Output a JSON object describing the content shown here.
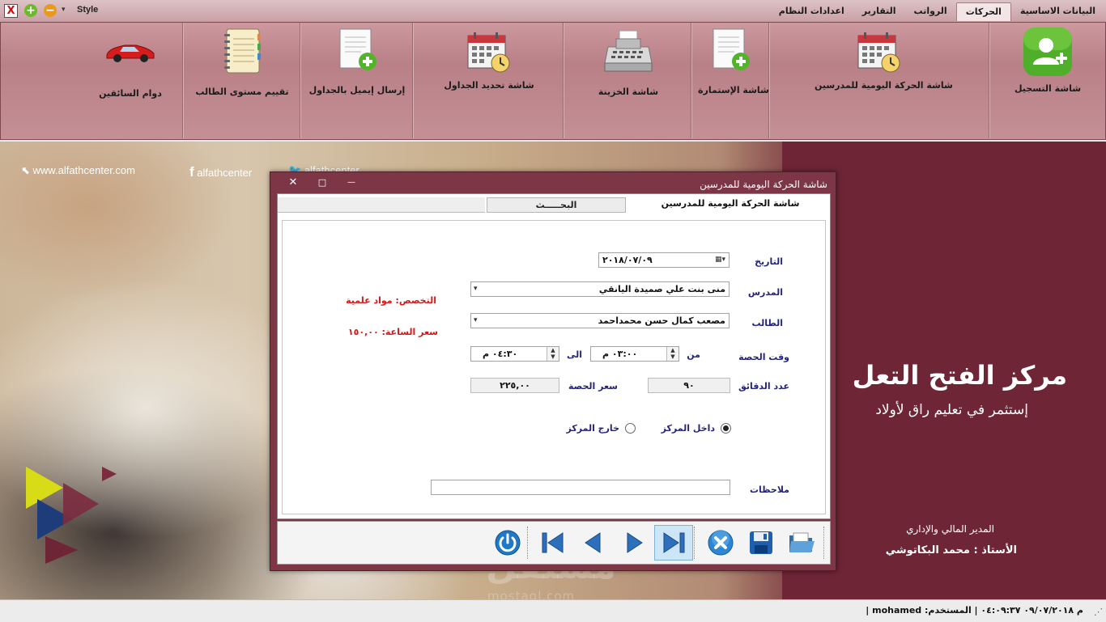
{
  "quick_access": {
    "close_glyph": "X",
    "add_glyph": "+",
    "remove_glyph": "−",
    "dropdown_glyph": "▾",
    "style_label": "Style"
  },
  "tabs": [
    "البيانات الاساسية",
    "الحركات",
    "الرواتب",
    "التقارير",
    "اعدادات النظام"
  ],
  "active_tab": "الحركات",
  "ribbon": {
    "buttons": [
      {
        "label": "شاشة التسجيل",
        "icon": "add-user-icon"
      },
      {
        "label": "شاشة الحركة اليومية للمدرسين",
        "icon": "calendar-clock-icon"
      },
      {
        "label": "شاشة الإستمارة",
        "icon": "form-add-icon"
      },
      {
        "label": "شاشة الخزينة",
        "icon": "cash-register-icon"
      },
      {
        "label": "شاشة تحديد الجداول",
        "icon": "calendar-clock-icon"
      },
      {
        "label": "إرسال إيميل بالجداول",
        "icon": "form-add-icon"
      },
      {
        "label": "تقييم مستوى الطالب",
        "icon": "notebook-icon"
      },
      {
        "label": "دوام السائقين",
        "icon": "car-icon"
      }
    ]
  },
  "banner": {
    "website": "www.alfathcenter.com",
    "facebook": "alfathcenter",
    "twitter": "alfathcenter",
    "title": "مركز الفتح التعل",
    "subtitle": "إستثمر في تعليم راق لأولاد",
    "manager_title": "المدير المالي والإداري",
    "manager_name": "الأستاذ : محمد البكاتوشي",
    "watermark": "مستقل",
    "watermark_url": "mostaql.com"
  },
  "dialog": {
    "title": "شاشة الحركة اليومية للمدرسين",
    "controls": {
      "close": "✕",
      "maximize": "□",
      "minimize": "—"
    },
    "tabs": {
      "active": "شاشة الحركة اليومية للمدرسين",
      "search": "البحـــــث"
    },
    "form": {
      "date_label": "التاريخ",
      "date_value": "٢٠١٨/٠٧/٠٩",
      "teacher_label": "المدرس",
      "teacher_value": "منى بنت علي صميدة اليانقي",
      "specialty": "التخصص: مواد علمية",
      "student_label": "الطالب",
      "student_value": "مصعب كمال حسن محمداحمد",
      "hour_rate": "سعر الساعة: ١٥٠,٠٠",
      "session_time_label": "وقت الحصة",
      "from_label": "من",
      "from_value": "٠٣:٠٠",
      "from_ampm": "م",
      "to_label": "الى",
      "to_value": "٠٤:٣٠",
      "to_ampm": "م",
      "minutes_label": "عدد الدقائق",
      "minutes_value": "٩٠",
      "session_price_label": "سعر الحصة",
      "session_price_value": "٢٢٥,٠٠",
      "inside_label": "داخل المركز",
      "outside_label": "خارج المركز",
      "inside_selected": true,
      "notes_label": "ملاحظات",
      "notes_value": ""
    },
    "footer_buttons": [
      "open-folder-icon",
      "save-icon",
      "cancel-icon",
      "last-record-icon",
      "next-icon",
      "previous-icon",
      "first-record-icon",
      "power-icon"
    ]
  },
  "status": {
    "text": "م ٠٩/٠٧/٢٠١٨ ٠٤:٠٩:٣٧ | المستخدم: mohamed |"
  },
  "colors": {
    "ribbon": "#b98087",
    "wine": "#6e2535",
    "dialog_frame": "#7d3645",
    "label_blue": "#24247a",
    "label_red": "#d21818"
  }
}
